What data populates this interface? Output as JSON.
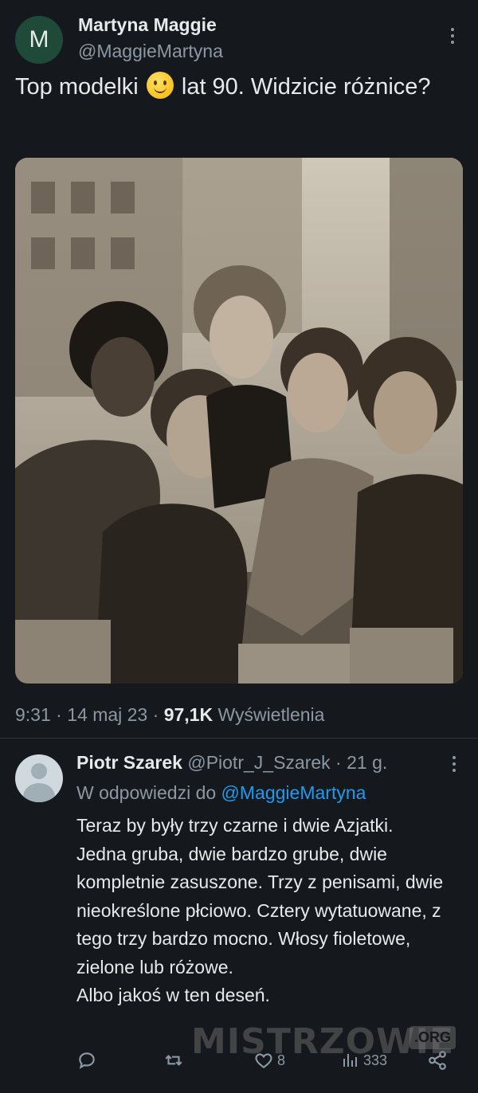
{
  "tweet": {
    "avatar_letter": "M",
    "author_name": "Martyna Maggie",
    "author_handle": "@MaggieMartyna",
    "text_before_emoji": "Top modelki",
    "emoji": "slightly-smiling-face",
    "text_after_emoji": " lat 90. Widzicie różnice?",
    "time": "9:31",
    "date": "14 maj 23",
    "views_count": "97,1K",
    "views_label": "Wyświetlenia",
    "separator": " · "
  },
  "reply": {
    "author_name": "Piotr Szarek",
    "author_handle": "@Piotr_J_Szarek",
    "age": "21 g.",
    "replying_prefix": "W odpowiedzi do ",
    "replying_to": "@MaggieMartyna",
    "text": "Teraz by były trzy czarne i dwie Azjatki.\nJedna gruba, dwie bardzo grube, dwie kompletnie zasuszone. Trzy z penisami, dwie nieokreślone płciowo. Cztery wytatuowane, z tego trzy bardzo mocno. Włosy fioletowe, zielone lub różowe.\nAlbo jakoś w ten deseń.",
    "likes": "8",
    "views": "333"
  },
  "watermark": {
    "text": "MISTRZOWIE",
    "suffix": ".ORG"
  },
  "colors": {
    "background": "#15181c",
    "text": "#e7e9ea",
    "secondary": "#8b98a5",
    "link": "#1d9bf0"
  }
}
